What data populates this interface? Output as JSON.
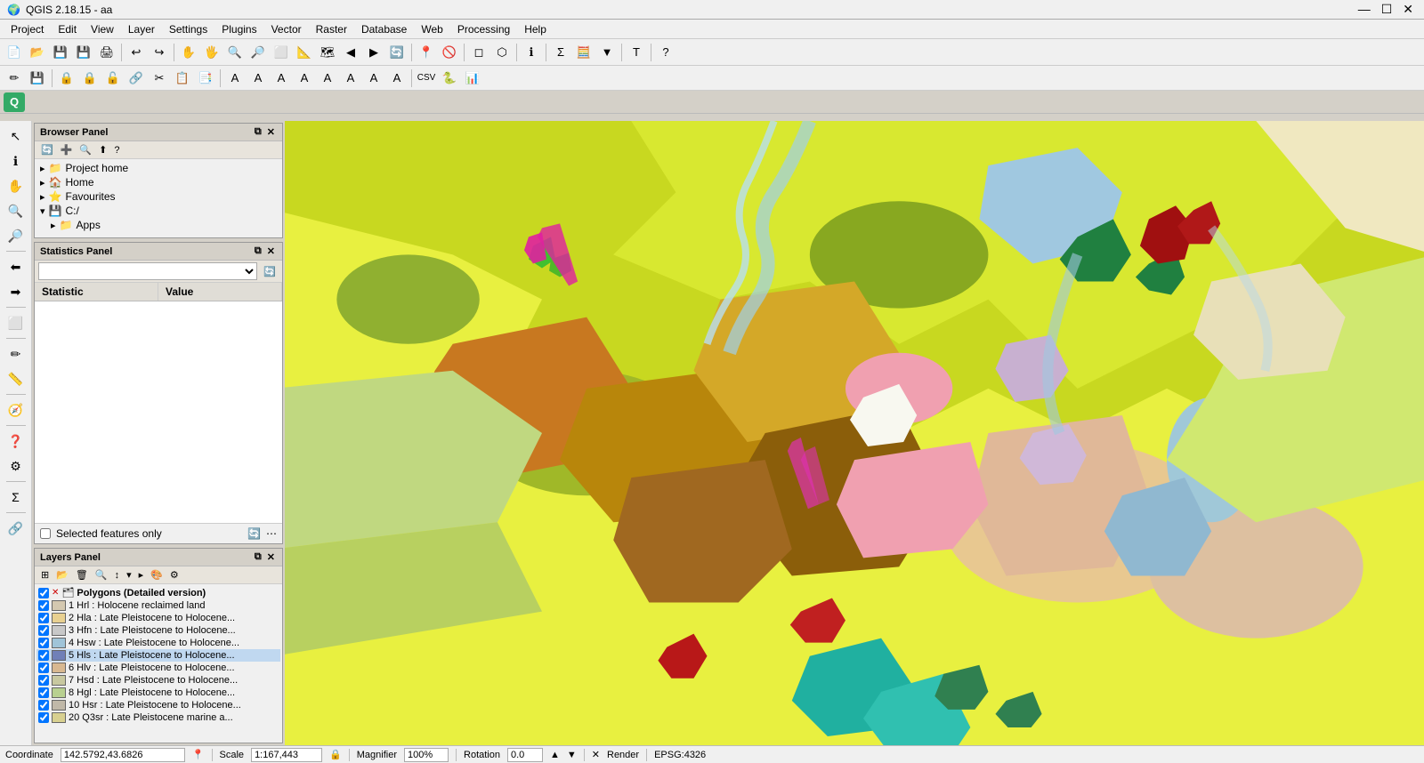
{
  "titleBar": {
    "title": "QGIS 2.18.15 - aa",
    "minimize": "—",
    "maximize": "☐",
    "close": "✕"
  },
  "menuBar": {
    "items": [
      "Project",
      "Edit",
      "View",
      "Layer",
      "Settings",
      "Plugins",
      "Vector",
      "Raster",
      "Database",
      "Web",
      "Processing",
      "Help"
    ]
  },
  "toolbar": {
    "buttons1": [
      "📁",
      "📂",
      "💾",
      "💾",
      "🖨",
      "⚙",
      "🔍",
      "✋",
      "🖐",
      "🔎",
      "🔍",
      "🔍",
      "🔍",
      "🔍",
      "🔍",
      "➡",
      "🔄",
      "💠",
      "▶",
      "⏭",
      "🔄",
      "🔍",
      "🔍",
      "🔍",
      "☰",
      "☰",
      "Σ",
      "☰",
      "▼",
      "T",
      "?"
    ],
    "buttons2": [
      "✏",
      "💾",
      "📋",
      "🔒",
      "🔒",
      "🔓",
      "🔗",
      "✂",
      "📋",
      "📑",
      "A",
      "A",
      "A",
      "A",
      "A",
      "A",
      "A",
      "A",
      "📄",
      "🐍",
      "📊"
    ]
  },
  "leftIcons": [
    "↖",
    "🎯",
    "✋",
    "🔍",
    "🔍",
    "⬅",
    "⬆",
    "🔲",
    "✏",
    "🖊",
    "🔺",
    "📏",
    "🧭",
    "❓",
    "🔧",
    "Σ",
    "🔗"
  ],
  "browserPanel": {
    "title": "Browser Panel",
    "items": [
      {
        "label": "Project home",
        "icon": "📁",
        "expanded": true
      },
      {
        "label": "Home",
        "icon": "🏠",
        "expanded": false
      },
      {
        "label": "Favourites",
        "icon": "⭐",
        "expanded": false
      },
      {
        "label": "C:/",
        "icon": "💾",
        "expanded": true
      },
      {
        "label": "Apps",
        "icon": "📁",
        "expanded": false
      }
    ]
  },
  "statisticsPanel": {
    "title": "Statistics Panel",
    "dropdown_placeholder": "",
    "columns": [
      {
        "label": "Statistic"
      },
      {
        "label": "Value"
      }
    ]
  },
  "selectedFeatures": {
    "label": "Selected features only",
    "checked": false
  },
  "layersPanel": {
    "title": "Layers Panel",
    "layers": [
      {
        "name": "Polygons (Detailed version)",
        "color": "#7b5ea7",
        "visible": true,
        "expanded": true
      },
      {
        "name": "1 Hrl : Holocene reclaimed land",
        "color": "#c8c8c8",
        "visible": true
      },
      {
        "name": "2 Hla : Late Pleistocene to Holocene...",
        "color": "#e8d8b0",
        "visible": true
      },
      {
        "name": "3 Hfn : Late Pleistocene to Holocene...",
        "color": "#d4d4d4",
        "visible": true
      },
      {
        "name": "4 Hsw : Late Pleistocene to Holocene...",
        "color": "#b8d4e0",
        "visible": true
      },
      {
        "name": "5 Hls : Late Pleistocene to Holocene...",
        "color": "#8090c8",
        "visible": true,
        "active": true
      },
      {
        "name": "6 Hlv : Late Pleistocene to Holocene...",
        "color": "#e0c0a0",
        "visible": true
      },
      {
        "name": "7 Hsd : Late Pleistocene to Holocene...",
        "color": "#d0d8b0",
        "visible": true
      },
      {
        "name": "8 Hgl : Late Pleistocene to Holocene...",
        "color": "#c0d090",
        "visible": true
      },
      {
        "name": "10 Hsr : Late Pleistocene to Holocene...",
        "color": "#d8c0b0",
        "visible": true
      },
      {
        "name": "20 Q3sr : Late Pleistocene marine a...",
        "color": "#e0d4a0",
        "visible": true
      }
    ]
  },
  "statusBar": {
    "coordinate_label": "Coordinate",
    "coordinate_value": "142.5792,43.6826",
    "scale_label": "Scale",
    "scale_value": "1:167,443",
    "magnifier_label": "Magnifier",
    "magnifier_value": "100%",
    "rotation_label": "Rotation",
    "rotation_value": "0.0",
    "render_label": "Render",
    "epsg_label": "EPSG:4326"
  },
  "mapPolygons": [
    {
      "color": "#e8f040",
      "label": "yellow"
    },
    {
      "color": "#c8d828",
      "label": "dark yellow"
    },
    {
      "color": "#90b030",
      "label": "olive"
    },
    {
      "color": "#d4a828",
      "label": "ochre"
    },
    {
      "color": "#b8860b",
      "label": "dark ochre"
    },
    {
      "color": "#c87820",
      "label": "brown"
    },
    {
      "color": "#e8c890",
      "label": "peach"
    },
    {
      "color": "#f0a0b0",
      "label": "pink"
    },
    {
      "color": "#d0b8c8",
      "label": "lavender"
    },
    {
      "color": "#a0c8e0",
      "label": "light blue"
    },
    {
      "color": "#40b8a0",
      "label": "teal"
    },
    {
      "color": "#e02060",
      "label": "magenta"
    },
    {
      "color": "#a01010",
      "label": "dark red"
    },
    {
      "color": "#ffffff",
      "label": "white"
    },
    {
      "color": "#30a030",
      "label": "green"
    },
    {
      "color": "#208040",
      "label": "dark green"
    }
  ]
}
